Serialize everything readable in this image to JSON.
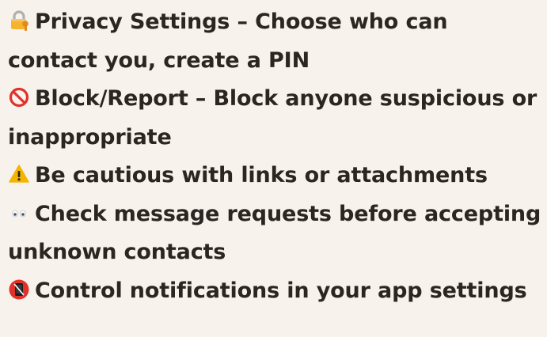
{
  "items": [
    {
      "icon": "locked-with-key-icon",
      "text": "Privacy Settings – Choose who can contact you, create a PIN"
    },
    {
      "icon": "prohibited-icon",
      "text": "Block/Report – Block anyone suspicious or inappropriate"
    },
    {
      "icon": "warning-icon",
      "text": "Be cautious with links or attachments"
    },
    {
      "icon": "eyes-icon",
      "text": "Check message requests before accepting unknown contacts"
    },
    {
      "icon": "mobile-phone-off-icon",
      "text": "Control notifications in your app settings"
    }
  ]
}
